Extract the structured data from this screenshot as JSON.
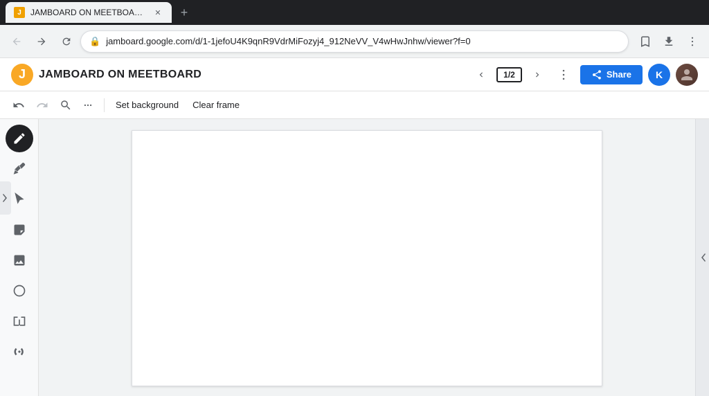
{
  "titleBar": {
    "tab": {
      "title": "JAMBOARD ON MEETBOAR...",
      "favicon": "J"
    },
    "newTabLabel": "+"
  },
  "addressBar": {
    "backBtn": "‹",
    "forwardBtn": "›",
    "reloadBtn": "↻",
    "url": "jamboard.google.com/d/1-1jefoU4K9qnR9VdrMiFozyj4_912NeVV_V4wHwJnhw/viewer?f=0",
    "bookmarkIcon": "☆",
    "downloadIcon": "⬇",
    "menuIcon": "⋮"
  },
  "appHeader": {
    "logoLetter": "J",
    "title": "JAMBOARD ON MEETBOARD",
    "prevPageBtn": "‹",
    "nextPageBtn": "›",
    "pageIndicator": "1/2",
    "moreBtn": "⋮",
    "shareBtn": "Share",
    "userInitial": "K",
    "avatarAlt": "User avatar"
  },
  "editToolbar": {
    "undoBtn": "↩",
    "redoBtn": "↪",
    "zoomInBtn": "🔍",
    "zoomMoreBtn": "•",
    "setBackgroundLabel": "Set background",
    "clearFrameLabel": "Clear frame"
  },
  "leftToolbar": {
    "tools": [
      {
        "name": "pen-tool",
        "icon": "✏",
        "active": true
      },
      {
        "name": "marker-tool",
        "icon": "▬"
      },
      {
        "name": "select-tool",
        "icon": "↖"
      },
      {
        "name": "sticky-note-tool",
        "icon": "▣"
      },
      {
        "name": "image-tool",
        "icon": "🖼"
      },
      {
        "name": "shape-tool",
        "icon": "○"
      },
      {
        "name": "text-frame-tool",
        "icon": "⊡"
      },
      {
        "name": "laser-tool",
        "icon": "✦"
      }
    ]
  },
  "canvas": {
    "bgColor": "#ffffff"
  },
  "colors": {
    "brand": "#f9a825",
    "shareBlue": "#1a73e8",
    "avatarBlue": "#1a73e8",
    "toolbarBg": "#f8f9fa",
    "border": "#e0e0e0"
  }
}
